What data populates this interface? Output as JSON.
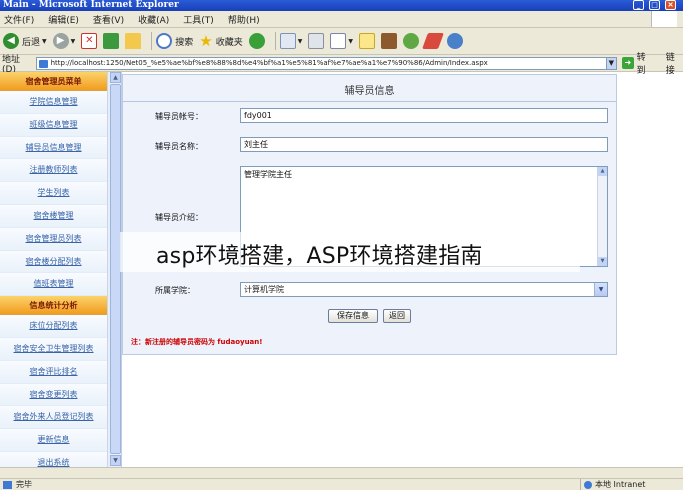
{
  "window": {
    "title": "Main - Microsoft Internet Explorer",
    "btn_min": "_",
    "btn_max": "□",
    "btn_close": "✕"
  },
  "menu": [
    "文件(F)",
    "编辑(E)",
    "查看(V)",
    "收藏(A)",
    "工具(T)",
    "帮助(H)"
  ],
  "toolbar": {
    "back": "后退",
    "search": "搜索",
    "favorites": "收藏夹"
  },
  "address": {
    "label": "地址(D)",
    "url": "http://localhost:1250/Net05_%e5%ae%bf%e8%88%8d%e4%bf%a1%e5%81%af%e7%ae%a1%e7%90%86/Admin/Index.aspx",
    "go": "转到",
    "links": "链接"
  },
  "sidebar": {
    "section1": "宿舍管理员菜单",
    "items1": [
      "学院信息管理",
      "班级信息管理",
      "辅导员信息管理",
      "注册教师列表",
      "学生列表",
      "宿舍楼管理",
      "宿舍管理员列表",
      "宿舍楼分配列表",
      "值班表管理"
    ],
    "section2": "信息统计分析",
    "items2": [
      "床位分配列表",
      "宿舍安全卫生管理列表",
      "宿舍评比排名",
      "宿舍变更列表",
      "宿舍外来人员登记列表",
      "更新信息",
      "退出系统"
    ]
  },
  "form": {
    "title": "辅导员信息",
    "account_label": "辅导员帐号：",
    "account_value": "fdy001",
    "name_label": "辅导员名称：",
    "name_value": "刘主任",
    "intro_label": "辅导员介绍：",
    "intro_value": "管理学院主任",
    "college_label": "所属学院：",
    "college_value": "计算机学院",
    "save_button": "保存信息",
    "back_button": "返回",
    "note": "注：新注册的辅导员密码为 fudaoyuan!"
  },
  "overlay_caption": "asp环境搭建，ASP环境搭建指南",
  "status": {
    "left": "完毕",
    "zone": "本地 Intranet"
  }
}
